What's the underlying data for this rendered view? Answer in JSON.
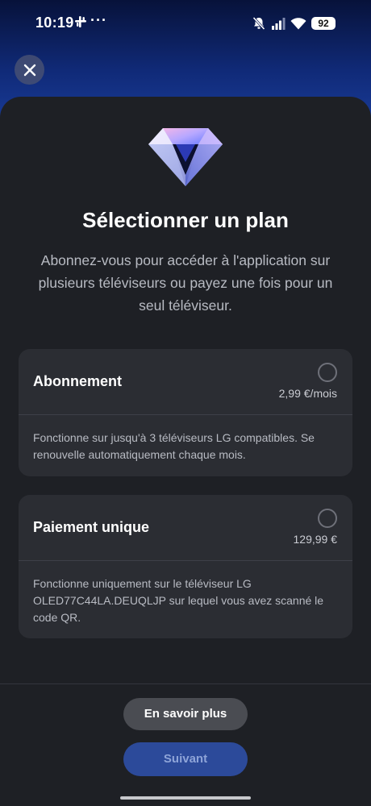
{
  "status_bar": {
    "time": "10:19",
    "more": "···",
    "battery": "92"
  },
  "icons": {
    "close": "close-icon",
    "slack": "slack-icon",
    "mute": "mute-bell-icon",
    "signal": "signal-icon",
    "wifi": "wifi-icon",
    "gem": "diamond-icon"
  },
  "colors": {
    "sheet_background": "#1e2025",
    "card_background": "#2b2d33",
    "primary_button": "#2c4a9a",
    "secondary_button": "#4a4c52"
  },
  "sheet": {
    "title": "Sélectionner un plan",
    "subtitle": "Abonnez-vous pour accéder à l'application sur plusieurs téléviseurs ou payez une fois pour un seul téléviseur."
  },
  "plans": [
    {
      "title": "Abonnement",
      "price": "2,99 €/mois",
      "description": "Fonctionne sur jusqu'à 3 téléviseurs LG compatibles. Se renouvelle automatiquement chaque mois.",
      "selected": false
    },
    {
      "title": "Paiement unique",
      "price": "129,99 €",
      "description": "Fonctionne uniquement sur le téléviseur LG OLED77C44LA.DEUQLJP sur lequel vous avez scanné le code QR.",
      "selected": false
    }
  ],
  "buttons": {
    "learn_more": "En savoir plus",
    "next": "Suivant"
  }
}
